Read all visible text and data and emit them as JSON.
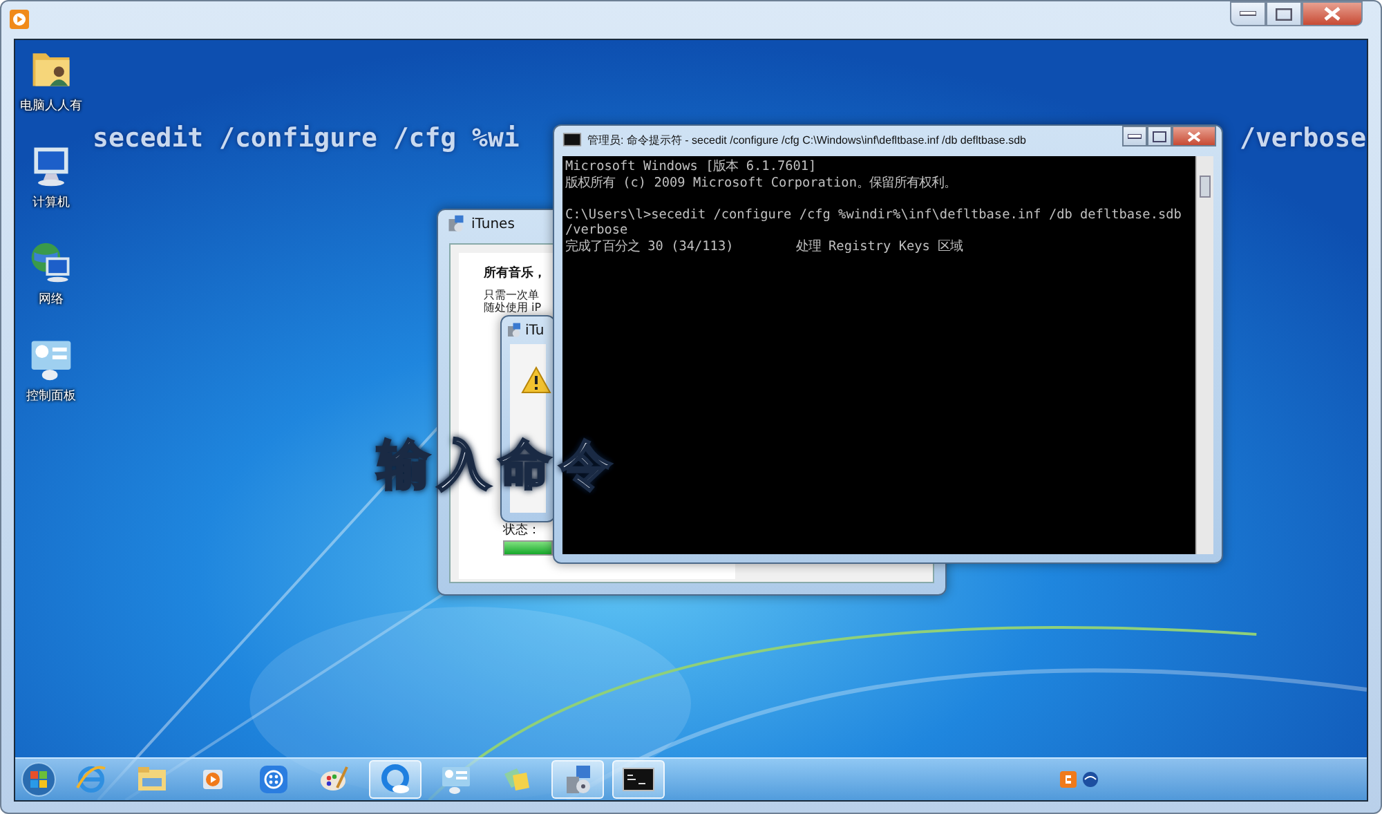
{
  "desktop_icons": [
    {
      "kind": "user-folder",
      "label": "电脑人人有"
    },
    {
      "kind": "computer",
      "label": "计算机"
    },
    {
      "kind": "network",
      "label": "网络"
    },
    {
      "kind": "control-panel",
      "label": "控制面板"
    }
  ],
  "captions": {
    "command_left": "secedit /configure /cfg %wi",
    "command_right": "/verbose",
    "title": "输入命令"
  },
  "itunes_dialog": {
    "title": "iTunes",
    "heading": "所有音乐，",
    "lines": [
      "只需一次单",
      "随处使用 iP"
    ],
    "status_label": "状态：",
    "progress": {
      "level": 1
    },
    "inner_dialog": {
      "title": "iTu"
    }
  },
  "cmd_window": {
    "title": "管理员: 命令提示符 - secedit /configure /cfg C:\\Windows\\inf\\defltbase.inf /db defltbase.sdb",
    "header_lines": [
      "Microsoft Windows [版本 6.1.7601]",
      "版权所有 (c) 2009 Microsoft Corporation。保留所有权利。"
    ],
    "command_lines": [
      "C:\\Users\\l>secedit /configure /cfg %windir%\\inf\\defltbase.inf /db defltbase.sdb",
      "/verbose",
      "完成了百分之 30 (34/113)        处理 Registry Keys 区域"
    ]
  },
  "taskbar": [
    {
      "kind": "ie",
      "active": false
    },
    {
      "kind": "explorer",
      "active": false
    },
    {
      "kind": "media",
      "active": false
    },
    {
      "kind": "app",
      "active": false
    },
    {
      "kind": "paint",
      "active": false
    },
    {
      "kind": "cloud",
      "active": true
    },
    {
      "kind": "control-panel",
      "active": false
    },
    {
      "kind": "notes",
      "active": false
    },
    {
      "kind": "installer",
      "active": true
    },
    {
      "kind": "cmd",
      "active": true
    }
  ]
}
